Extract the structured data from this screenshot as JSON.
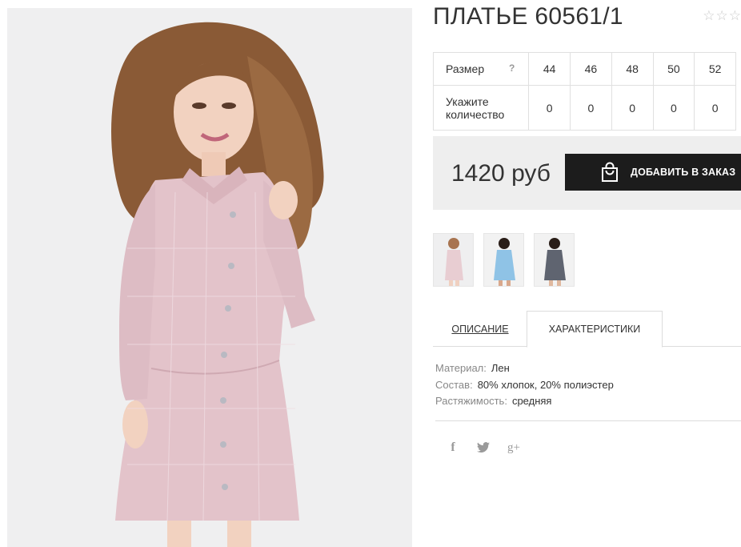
{
  "product": {
    "title": "ПЛАТЬЕ 60561/1",
    "rating_stars": [
      "☆",
      "☆",
      "☆"
    ]
  },
  "sizes": {
    "size_label": "Размер",
    "help_label": "?",
    "qty_label": "Укажите количество",
    "columns": [
      {
        "size": "44",
        "qty": "0"
      },
      {
        "size": "46",
        "qty": "0"
      },
      {
        "size": "48",
        "qty": "0"
      },
      {
        "size": "50",
        "qty": "0"
      },
      {
        "size": "52",
        "qty": "0"
      }
    ]
  },
  "order": {
    "price": "1420 руб",
    "add_button_label": "ДОБАВИТЬ В ЗАКАЗ",
    "add_button_icon": "shopping-bag-icon"
  },
  "thumbnails": [
    {
      "name": "pink-dress-thumb",
      "color": "#e8cdd2"
    },
    {
      "name": "blue-dress-thumb",
      "color": "#8fc3e6"
    },
    {
      "name": "gray-dress-thumb",
      "color": "#5f6470"
    }
  ],
  "tabs": [
    {
      "label": "ОПИСАНИЕ",
      "active": false
    },
    {
      "label": "ХАРАКТЕРИСТИКИ",
      "active": true
    }
  ],
  "specs": [
    {
      "key": "Материал:",
      "value": "Лен"
    },
    {
      "key": "Состав:",
      "value": "80% хлопок, 20% полиэстер"
    },
    {
      "key": "Растяжимость:",
      "value": "средняя"
    }
  ],
  "social": [
    {
      "icon": "facebook-icon",
      "glyph": "f"
    },
    {
      "icon": "twitter-icon",
      "glyph": ""
    },
    {
      "icon": "google-plus-icon",
      "glyph": "g+"
    }
  ],
  "colors": {
    "button_bg": "#1c1c1c",
    "price_box_bg": "#eeeeee",
    "dress_pink": "#e3c3ca"
  }
}
